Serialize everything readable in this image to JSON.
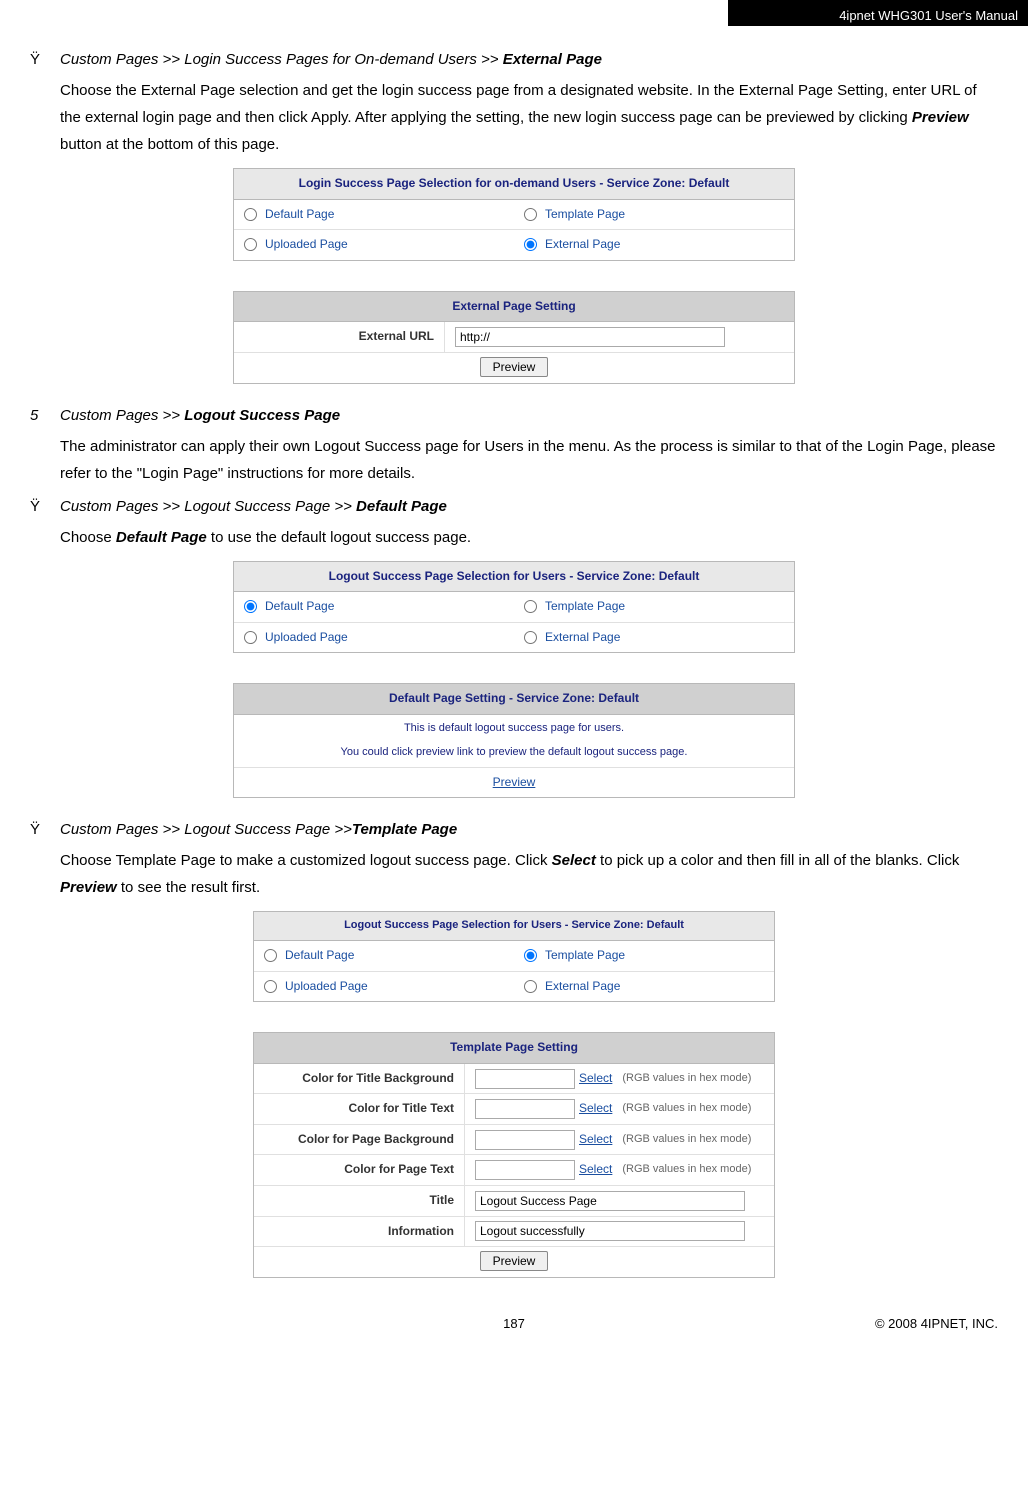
{
  "header": {
    "product": "4ipnet WHG301 User's Manual"
  },
  "section1": {
    "bullet": "Ÿ",
    "breadcrumb_prefix": "Custom Pages >> Login Success Pages for On-demand Users >> ",
    "breadcrumb_bold": "External Page",
    "para": "Choose the External Page selection and get the login success page from a designated website. In the External Page Setting, enter URL of the external login page and then click Apply. After applying the setting, the new login success page can be previewed by clicking ",
    "para_bold": "Preview",
    "para_tail": " button at the bottom of this page."
  },
  "fig1": {
    "panelA": {
      "title": "Login Success Page Selection for on-demand Users - Service Zone: Default",
      "opt1": "Default Page",
      "opt2": "Template Page",
      "opt3": "Uploaded Page",
      "opt4": "External Page",
      "selected": "opt4"
    },
    "panelB": {
      "title": "External Page Setting",
      "label": "External URL",
      "value": "http://",
      "btn": "Preview"
    }
  },
  "section2": {
    "num": "5",
    "breadcrumb_prefix": "Custom Pages >> ",
    "breadcrumb_bold": "Logout Success Page",
    "para": "The administrator can apply their own Logout Success page for Users in the menu. As the process is similar to that of the Login Page, please refer to the \"Login Page\" instructions for more details."
  },
  "section3": {
    "bullet": "Ÿ",
    "breadcrumb_prefix": "Custom Pages >> Logout Success Page >> ",
    "breadcrumb_bold": "Default Page",
    "para_pre": "Choose ",
    "para_bold": "Default Page",
    "para_post": " to use the default logout success page."
  },
  "fig2": {
    "panelA": {
      "title": "Logout Success Page Selection for Users - Service Zone: Default",
      "opt1": "Default Page",
      "opt2": "Template Page",
      "opt3": "Uploaded Page",
      "opt4": "External Page",
      "selected": "opt1"
    },
    "panelB": {
      "title": "Default Page Setting - Service Zone: Default",
      "note1": "This is default logout success page for users.",
      "note2": "You could click preview link to preview the default logout success page.",
      "link": "Preview"
    }
  },
  "section4": {
    "bullet": "Ÿ",
    "breadcrumb_prefix": "Custom Pages >> Logout Success Page >>",
    "breadcrumb_bold": "Template Page",
    "para_pre": "Choose Template Page to make a customized logout success page. Click ",
    "para_bold1": "Select",
    "para_mid": " to pick up a color and then fill in all of the blanks. Click ",
    "para_bold2": "Preview",
    "para_post": " to see the result first."
  },
  "fig3": {
    "panelA": {
      "title": "Logout Success Page Selection for Users - Service Zone: Default",
      "opt1": "Default Page",
      "opt2": "Template Page",
      "opt3": "Uploaded Page",
      "opt4": "External Page",
      "selected": "opt2"
    },
    "panelB": {
      "title": "Template Page Setting",
      "rows": [
        {
          "label": "Color for Title Background",
          "link": "Select",
          "hint": "(RGB values in hex mode)",
          "type": "color"
        },
        {
          "label": "Color for Title Text",
          "link": "Select",
          "hint": "(RGB values in hex mode)",
          "type": "color"
        },
        {
          "label": "Color for Page Background",
          "link": "Select",
          "hint": "(RGB values in hex mode)",
          "type": "color"
        },
        {
          "label": "Color for Page Text",
          "link": "Select",
          "hint": "(RGB values in hex mode)",
          "type": "color"
        },
        {
          "label": "Title",
          "value": "Logout Success Page",
          "type": "text"
        },
        {
          "label": "Information",
          "value": "Logout successfully",
          "type": "text"
        }
      ],
      "btn": "Preview"
    }
  },
  "footer": {
    "page": "187",
    "copyright": "© 2008 4IPNET, INC."
  }
}
